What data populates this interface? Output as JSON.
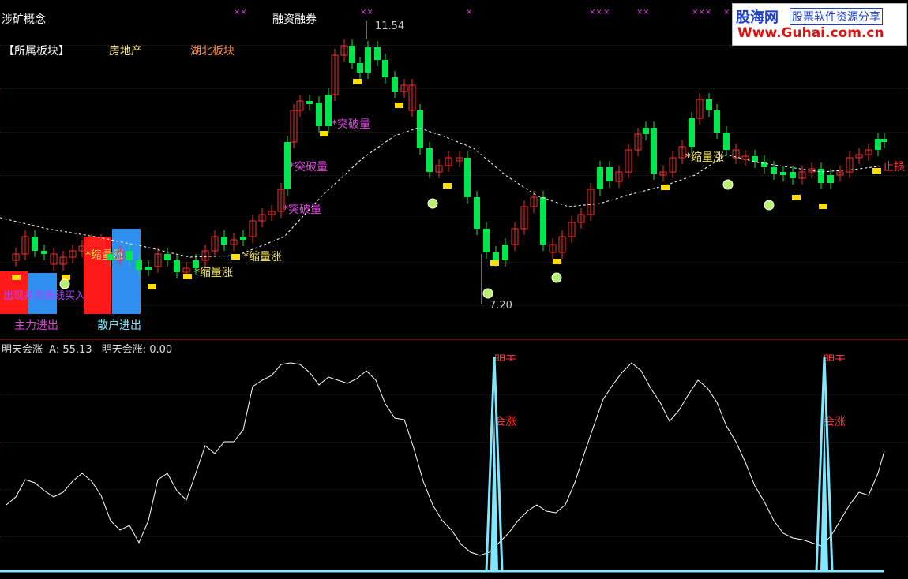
{
  "header": {
    "concept_label": "涉矿概念",
    "margin_label": "融资融券",
    "x_marks": [
      "××",
      "××",
      "×",
      "××",
      "×",
      "××",
      "×××",
      "×"
    ],
    "sector_label": "【所属板块】",
    "sector_1": "房地产",
    "sector_2": "湖北板块"
  },
  "logo": {
    "brand": "股海网",
    "slogan": "股票软件资源分享",
    "url": "Www.Guhai.com.cn"
  },
  "price_panel": {
    "high_label": "11.54",
    "low_label": "7.20",
    "legend": {
      "main_force": "主力进出",
      "retail": "散户进出",
      "overlay_text": "出现并黄色线买入"
    },
    "annotations": {
      "breakout_1": "*突破量",
      "breakout_2": "*突破量",
      "breakout_3": "*突破量",
      "shrink_1": "*缩量涨",
      "shrink_2": "*缩量涨",
      "shrink_3": "*缩量涨",
      "shrink_4": "*缩量涨",
      "stop_loss": "止损"
    }
  },
  "indicator_panel": {
    "title": "明天会涨",
    "a_label": "A:",
    "a_value": "55.13",
    "b_label": "明天会涨:",
    "b_value": "0.00",
    "signal_1_top": "明天",
    "signal_1_bottom": "会涨",
    "signal_2_top": "明天",
    "signal_2_bottom": "会涨"
  },
  "colors": {
    "up": "#ff2a2a",
    "down": "#00e64d",
    "ma": "#ffffff",
    "volume_marker": "#ffdd00",
    "signal": "#7fe8ff",
    "label_magenta": "#e040e0",
    "label_yellow": "#ffee55",
    "label_orange": "#ff8833"
  }
}
